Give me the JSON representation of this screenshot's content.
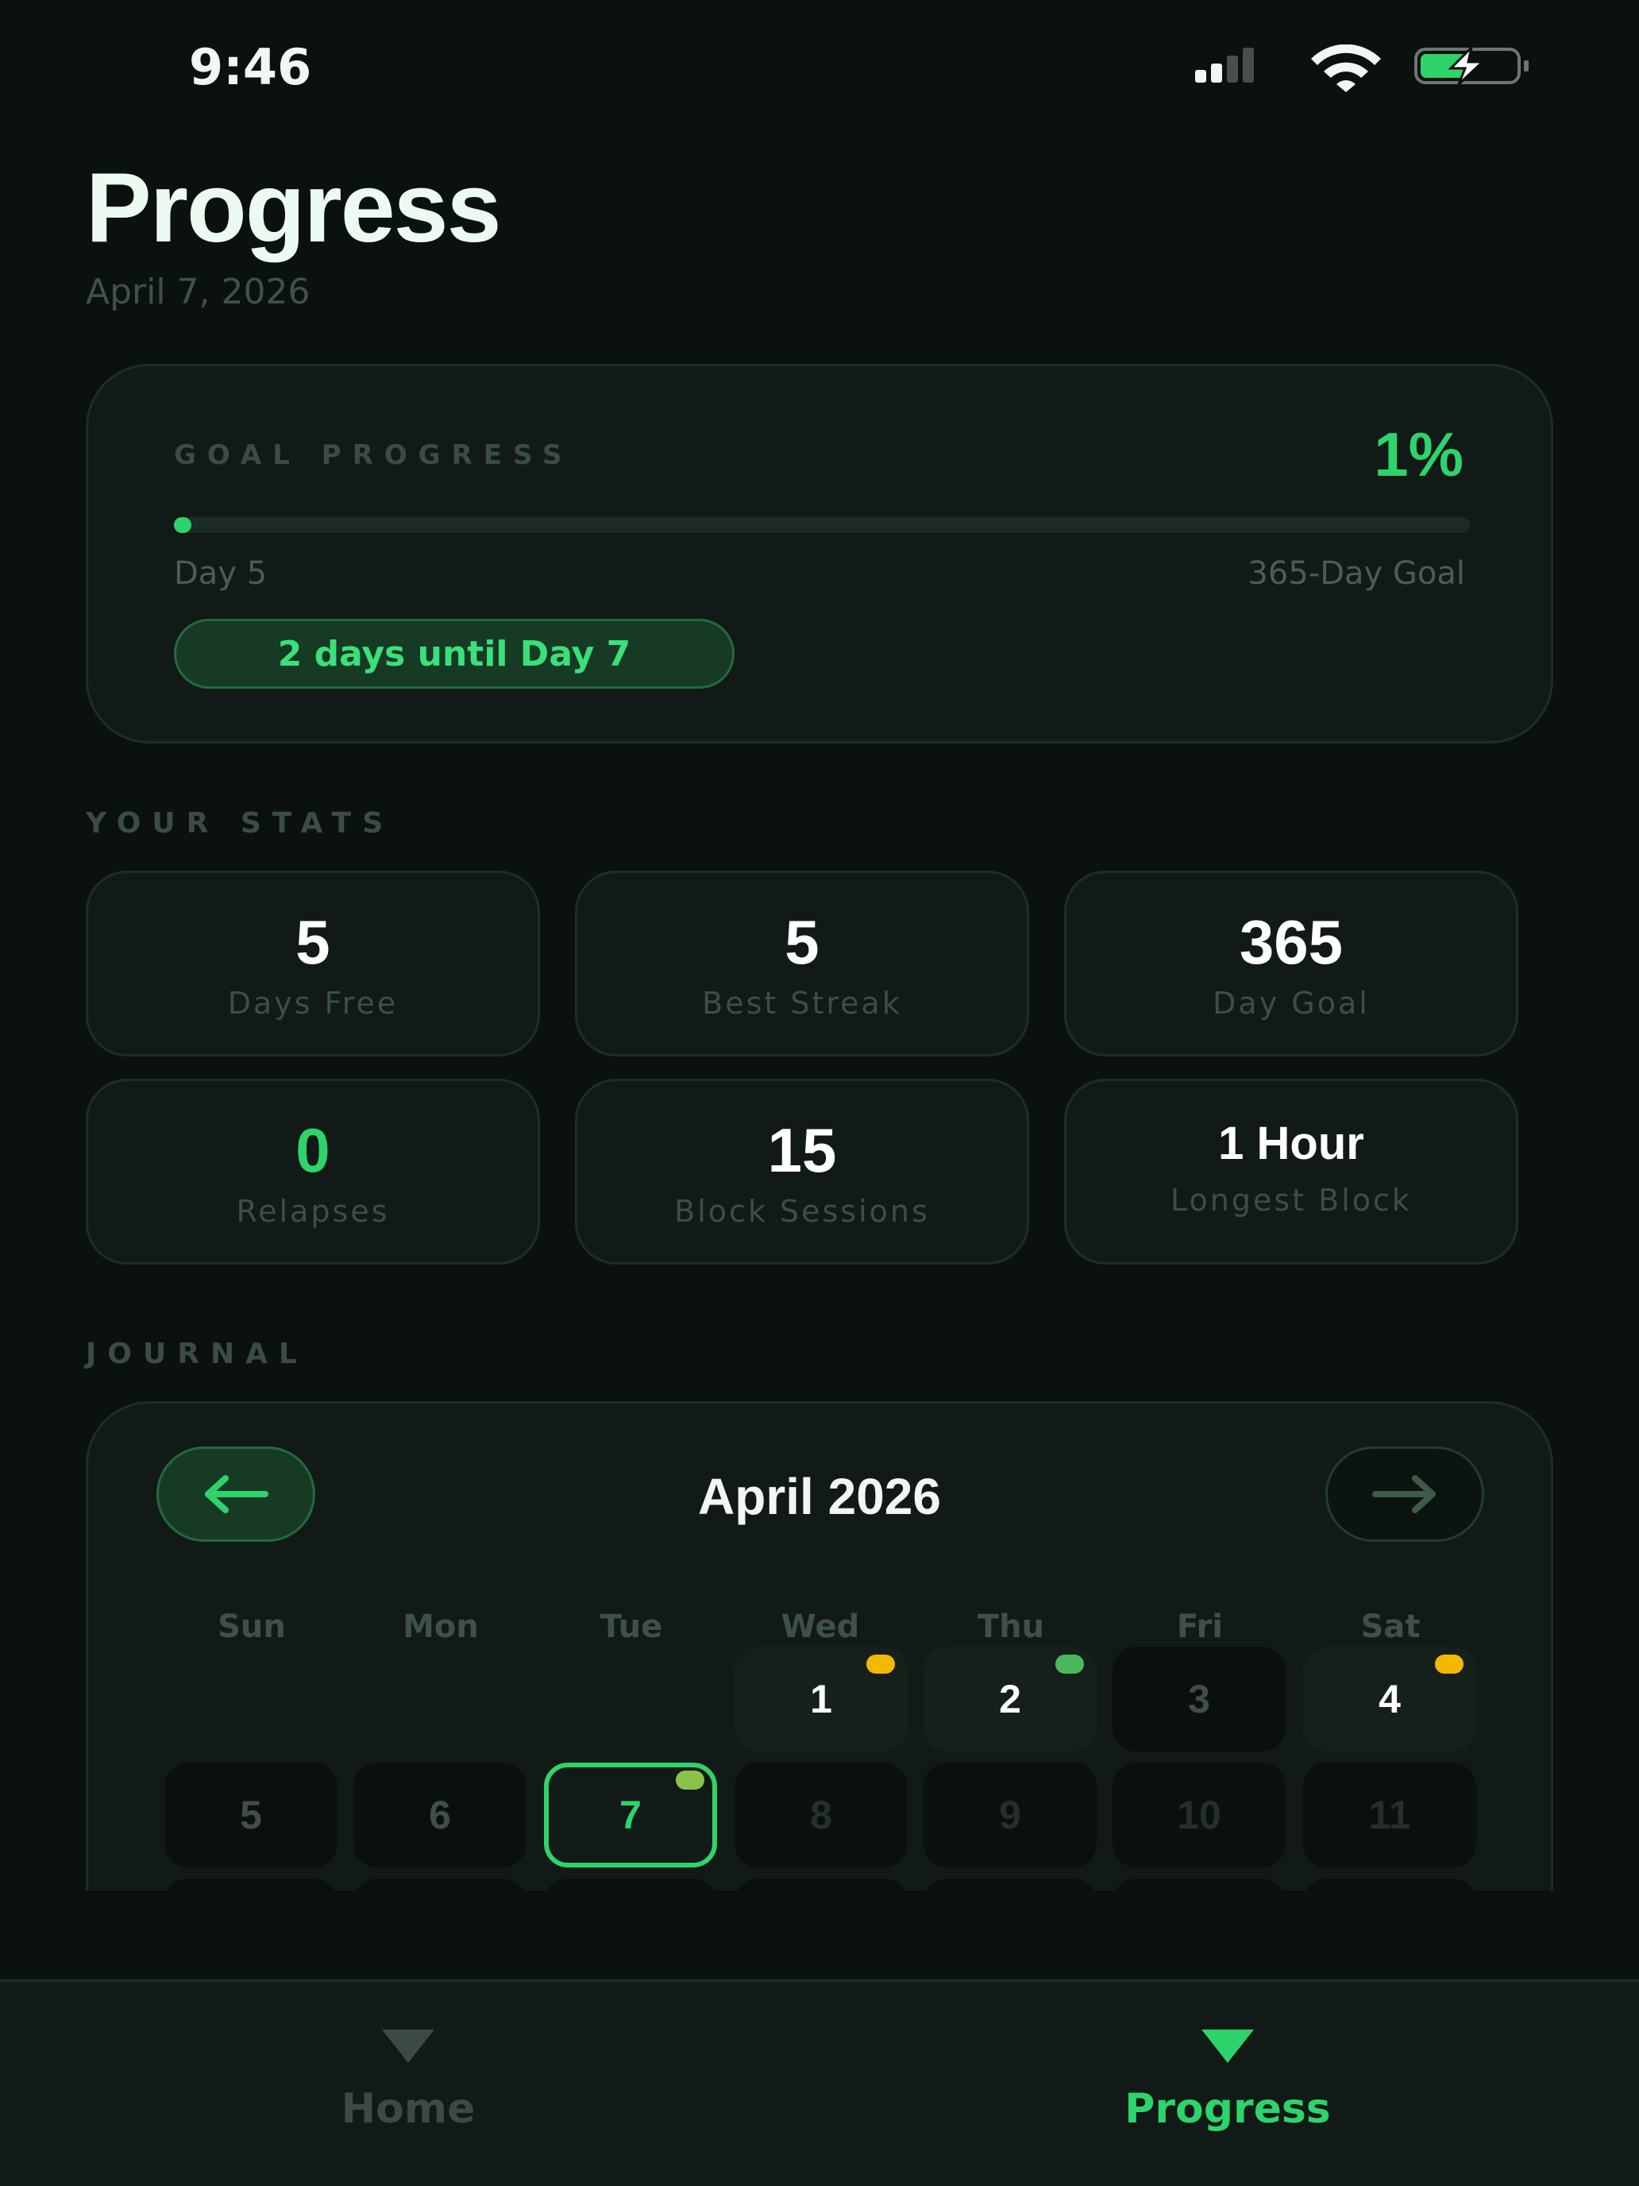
{
  "status_bar": {
    "time": "9:46"
  },
  "header": {
    "title": "Progress",
    "date": "April 7, 2026"
  },
  "goal": {
    "label": "GOAL PROGRESS",
    "percent_text": "1%",
    "progress_fraction": 0.013,
    "start_label": "Day 5",
    "end_label": "365-Day Goal",
    "milestone_text": "2 days until Day 7"
  },
  "stats": {
    "section_label": "YOUR STATS",
    "items": [
      {
        "value": "5",
        "label": "Days Free"
      },
      {
        "value": "5",
        "label": "Best Streak"
      },
      {
        "value": "365",
        "label": "Day Goal"
      },
      {
        "value": "0",
        "label": "Relapses"
      },
      {
        "value": "15",
        "label": "Block Sessions"
      },
      {
        "value": "1 Hour",
        "label": "Longest Block"
      }
    ]
  },
  "journal": {
    "section_label": "JOURNAL",
    "month": "April 2026",
    "weekdays": [
      "Sun",
      "Mon",
      "Tue",
      "Wed",
      "Thu",
      "Fri",
      "Sat"
    ],
    "days": [
      {
        "day": "1",
        "state": "logged",
        "dot": "#f5b800"
      },
      {
        "day": "2",
        "state": "logged",
        "dot": "#4cb85c"
      },
      {
        "day": "3",
        "state": "past"
      },
      {
        "day": "4",
        "state": "logged",
        "dot": "#f5b800"
      },
      {
        "day": "5",
        "state": "past"
      },
      {
        "day": "6",
        "state": "past"
      },
      {
        "day": "7",
        "state": "today",
        "dot": "#8bc34a"
      },
      {
        "day": "8",
        "state": "future"
      },
      {
        "day": "9",
        "state": "future"
      },
      {
        "day": "10",
        "state": "future"
      },
      {
        "day": "11",
        "state": "future"
      }
    ]
  },
  "tabs": [
    {
      "label": "Home",
      "active": false
    },
    {
      "label": "Progress",
      "active": true
    }
  ],
  "colors": {
    "accent": "#2ed36b",
    "inactive": "#3b4a43",
    "background": "#0b110f",
    "card": "#111a16"
  }
}
